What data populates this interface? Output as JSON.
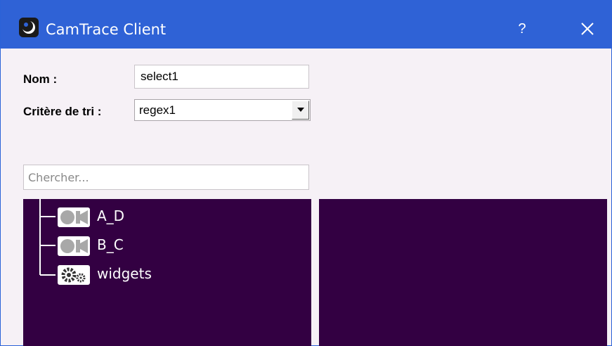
{
  "window": {
    "title": "CamTrace Client",
    "help_label": "?",
    "titlebar_color": "#2f62d6"
  },
  "form": {
    "name_label": "Nom :",
    "name_value": "select1",
    "sort_label": "Critère de tri :",
    "sort_value": "regex1"
  },
  "search": {
    "placeholder": "Chercher..."
  },
  "tree": {
    "items": [
      {
        "label": "A_D",
        "icon": "camera-icon"
      },
      {
        "label": "B_C",
        "icon": "camera-icon"
      },
      {
        "label": "widgets",
        "icon": "gears-icon"
      }
    ]
  },
  "colors": {
    "panel_bg": "#330042",
    "window_bg": "#f6f1f6"
  }
}
